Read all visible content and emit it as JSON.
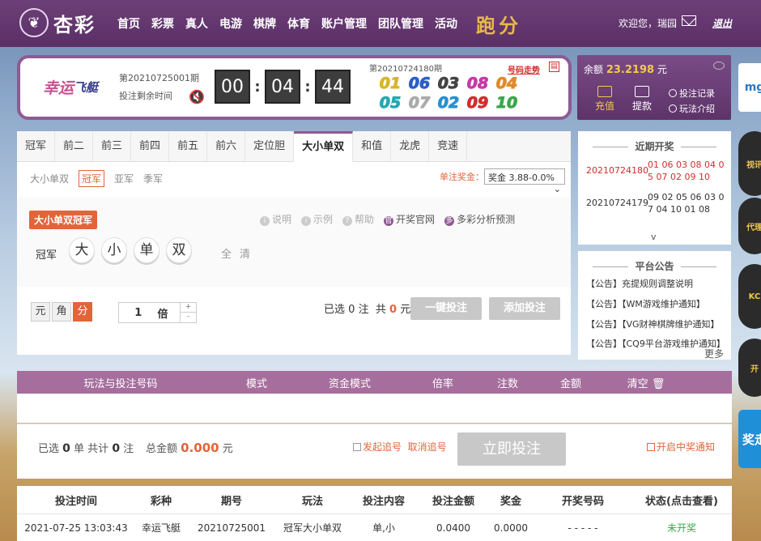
{
  "header": {
    "logo_text": "杏彩",
    "nav": [
      "首页",
      "彩票",
      "真人",
      "电游",
      "棋牌",
      "体育",
      "账户管理",
      "团队管理",
      "活动"
    ],
    "paofen": "跑分",
    "welcome": "欢迎您，瑞园",
    "logout": "退出"
  },
  "game": {
    "logo_main": "幸运",
    "logo_sub": "飞艇",
    "current_issue": "第20210725001期",
    "remain_label": "投注剩余时间",
    "timer": [
      "00",
      "04",
      "44"
    ],
    "prev_issue": "第20210724180期",
    "trend_label": "号码走势",
    "prev_numbers": [
      "01",
      "06",
      "03",
      "08",
      "04",
      "05",
      "07",
      "02",
      "09",
      "10"
    ],
    "ball_colors": [
      "#d9b42a",
      "#2a5fc9",
      "#444444",
      "#c83aa8",
      "#e08a2a",
      "#24a8b0",
      "#aaaaaa",
      "#2a8fd0",
      "#d42c2c",
      "#3aa84a"
    ]
  },
  "account": {
    "balance_label": "余额",
    "balance": "23.2198",
    "currency": "元",
    "deposit": "充值",
    "withdraw": "提款",
    "bet_records": "投注记录",
    "play_intro": "玩法介绍"
  },
  "tabs": [
    "冠军",
    "前二",
    "前三",
    "前四",
    "前五",
    "前六",
    "定位胆",
    "大小单双",
    "和值",
    "龙虎",
    "竞速"
  ],
  "subtabs": [
    "大小单双",
    "冠军",
    "亚军",
    "季军"
  ],
  "prize": {
    "label": "单注奖金：",
    "select": "奖金 3.88-0.0%"
  },
  "play": {
    "title": "大小单双冠军",
    "helps": [
      "说明",
      "示例",
      "帮助",
      "开奖官网",
      "多彩分析预测"
    ],
    "position": "冠军",
    "picks": [
      "大",
      "小",
      "单",
      "双"
    ],
    "quick": [
      "全",
      "清"
    ]
  },
  "bet": {
    "units": [
      "元",
      "角",
      "分"
    ],
    "multiple": "1",
    "multiple_label": "倍",
    "plus": "+",
    "minus": "-",
    "selected_prefix": "已选",
    "selected_count": "0",
    "selected_unit": "注",
    "total_prefix": "共",
    "total": "0",
    "total_unit": "元",
    "one_click": "一键投注",
    "add_bet": "添加投注"
  },
  "recent": {
    "title": "近期开奖",
    "draws": [
      {
        "issue": "20210724180",
        "numbers": "01 06 03 08 04 0 5 07 02 09 10"
      },
      {
        "issue": "20210724179",
        "numbers": "09 02 05 06 03 0 7 04 10 01 08"
      }
    ],
    "expand": "v"
  },
  "notices": {
    "title": "平台公告",
    "items": [
      "【公告】充提规则调整说明",
      "【公告】【WM游戏维护通知】",
      "【公告】【VG财神棋牌维护通知】",
      "【公告】【CQ9平台游戏维护通知】"
    ],
    "more": "更多"
  },
  "cart": {
    "headers": [
      "玩法与投注号码",
      "模式",
      "资金模式",
      "倍率",
      "注数",
      "金额",
      "清空"
    ],
    "summary_prefix": "已选",
    "summary_count": "0",
    "summary_mid": "单 共计",
    "summary_bets": "0",
    "summary_unit": "注",
    "total_label": "总金额",
    "total_amount": "0.000",
    "total_unit": "元",
    "chase": "发起追号",
    "cancel_chase": "取消追号",
    "bet_now": "立即投注",
    "win_notify": "开启中奖通知"
  },
  "records": {
    "headers": [
      "投注时间",
      "彩种",
      "期号",
      "玩法",
      "投注内容",
      "投注金额",
      "奖金",
      "开奖号码",
      "状态(点击查看)"
    ],
    "rows": [
      {
        "time": "2021-07-25 13:03:43",
        "game": "幸运飞艇",
        "issue": "20210725001",
        "play": "冠军大小单双",
        "content": "单,小",
        "amount": "0.0400",
        "prize": "0.0000",
        "numbers": "- - - - -",
        "status": "未开奖"
      }
    ]
  },
  "sidebar": {
    "items": [
      "mg",
      "视讯",
      "代理",
      "KC",
      "开",
      "奖走"
    ]
  }
}
